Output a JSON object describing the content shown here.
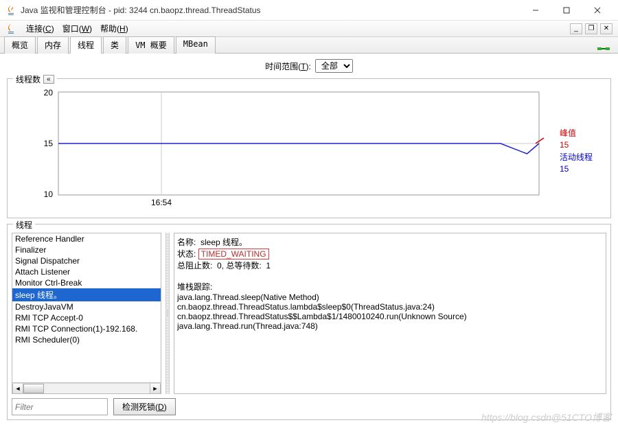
{
  "window": {
    "title": "Java 监视和管理控制台 - pid: 3244 cn.baopz.thread.ThreadStatus"
  },
  "menu": {
    "connect": "连接",
    "connect_key": "C",
    "window": "窗口",
    "window_key": "W",
    "help": "帮助",
    "help_key": "H"
  },
  "tabs": [
    "概览",
    "内存",
    "线程",
    "类",
    "VM 概要",
    "MBean"
  ],
  "active_tab_index": 2,
  "timerange": {
    "label": "时间范围",
    "label_key": "T",
    "colon": ":",
    "value": "全部"
  },
  "chart": {
    "group_label": "线程数",
    "collapse_glyph": "«",
    "peak_label": "峰值",
    "peak_value": "15",
    "live_label": "活动线程",
    "live_value": "15"
  },
  "chart_data": {
    "type": "line",
    "title": "线程数",
    "xlabel": "",
    "ylabel": "",
    "ylim": [
      10,
      20
    ],
    "yticks": [
      10,
      15,
      20
    ],
    "xticks_labels": [
      "16:54"
    ],
    "series": [
      {
        "name": "活动线程",
        "color": "#2020d0",
        "x": [
          0,
          0.92,
          0.975,
          1.0
        ],
        "y": [
          15,
          15,
          14,
          15
        ]
      }
    ],
    "peak": 15,
    "live": 15
  },
  "threads": {
    "group_label": "线程",
    "list": [
      "Reference Handler",
      "Finalizer",
      "Signal Dispatcher",
      "Attach Listener",
      "Monitor Ctrl-Break",
      "sleep 线程。",
      "DestroyJavaVM",
      "RMI TCP Accept-0",
      "RMI TCP Connection(1)-192.168.",
      "RMI Scheduler(0)"
    ],
    "selected_index": 5,
    "detail": {
      "name_label": "名称:",
      "name_value": "sleep 线程。",
      "state_label": "状态:",
      "state_value": "TIMED_WAITING",
      "blocked_label": "总阻止数:",
      "blocked_value": "0,",
      "waited_label": "总等待数:",
      "waited_value": "1",
      "stack_label": "堆栈跟踪:",
      "stack": [
        "java.lang.Thread.sleep(Native Method)",
        "cn.baopz.thread.ThreadStatus.lambda$sleep$0(ThreadStatus.java:24)",
        "cn.baopz.thread.ThreadStatus$$Lambda$1/1480010240.run(Unknown Source)",
        "java.lang.Thread.run(Thread.java:748)"
      ]
    }
  },
  "filter": {
    "placeholder": "Filter"
  },
  "deadlock": {
    "label": "检测死锁",
    "key": "D"
  },
  "watermark": "https://blog.csdn@51CTO博客"
}
